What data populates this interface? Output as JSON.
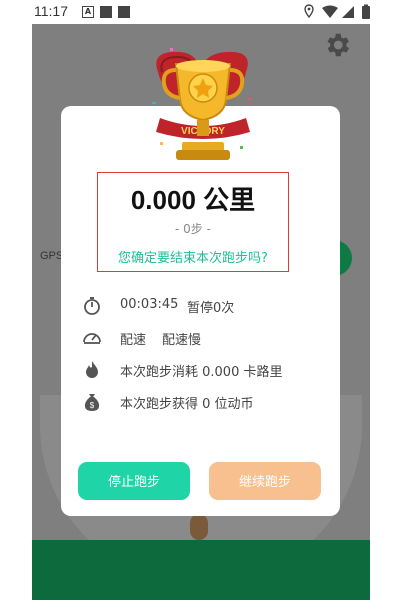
{
  "status_bar": {
    "time": "11:17",
    "icons": [
      "notification-a-icon",
      "square-icon",
      "square-icon",
      "location-icon",
      "wifi-icon",
      "signal-icon",
      "battery-icon"
    ]
  },
  "background": {
    "gps_label": "GPS"
  },
  "dialog": {
    "distance": "0.000 公里",
    "steps": "- 0步 -",
    "confirm_question": "您确定要结束本次跑步吗?",
    "duration": "00:03:45",
    "pauses": "暂停0次",
    "pace_label": "配速",
    "pace_value": "配速慢",
    "calories": "本次跑步消耗 0.000 卡路里",
    "coins": "本次跑步获得 0 位动币",
    "stop_button": "停止跑步",
    "continue_button": "继续跑步"
  },
  "colors": {
    "accent_green": "#1fd5a8",
    "accent_orange": "#f8c08e",
    "highlight_red": "#e03a3a",
    "question_teal": "#1fbf9a"
  }
}
